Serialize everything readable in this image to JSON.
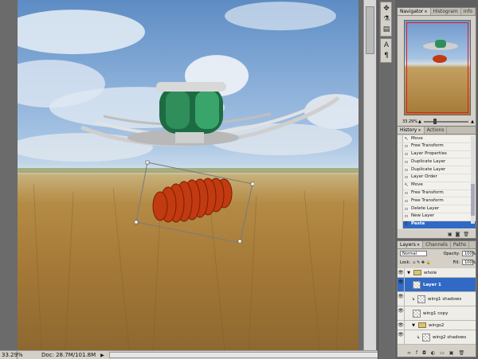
{
  "status": {
    "zoom": "33.29%",
    "doc": "Doc: 28.7M/101.8M"
  },
  "tool_icons": [
    "move-arrows-icon",
    "brush-stack-icon",
    "layer-comp-icon",
    "character-icon",
    "paragraph-icon"
  ],
  "navigator": {
    "tabs": [
      "Navigator",
      "Histogram",
      "Info"
    ],
    "zoom": "33.29%"
  },
  "history": {
    "tabs": [
      "History",
      "Actions"
    ],
    "items": [
      {
        "label": "Move",
        "icon": "move-arrow-icon"
      },
      {
        "label": "Free Transform",
        "icon": "transform-icon"
      },
      {
        "label": "Layer Properties",
        "icon": "layer-icon"
      },
      {
        "label": "Duplicate Layer",
        "icon": "layer-icon"
      },
      {
        "label": "Duplicate Layer",
        "icon": "layer-icon"
      },
      {
        "label": "Layer Order",
        "icon": "layer-icon"
      },
      {
        "label": "Move",
        "icon": "move-arrow-icon"
      },
      {
        "label": "Free Transform",
        "icon": "transform-icon"
      },
      {
        "label": "Free Transform",
        "icon": "transform-icon"
      },
      {
        "label": "Delete Layer",
        "icon": "layer-icon"
      },
      {
        "label": "New Layer",
        "icon": "layer-icon"
      },
      {
        "label": "Paste",
        "icon": "paste-icon",
        "selected": true
      }
    ]
  },
  "layers": {
    "tabs": [
      "Layers",
      "Channels",
      "Paths"
    ],
    "blend_mode": "Normal",
    "opacity_label": "Opacity:",
    "opacity": "100%",
    "lock_label": "Lock:",
    "fill_label": "Fill:",
    "fill": "100%",
    "items": [
      {
        "name": "whole",
        "type": "group"
      },
      {
        "name": "Layer 1",
        "type": "layer",
        "selected": true
      },
      {
        "name": "wing1 shadows",
        "type": "layer"
      },
      {
        "name": "wing1 copy",
        "type": "layer"
      },
      {
        "name": "wings2",
        "type": "group"
      },
      {
        "name": "wing2 shadows",
        "type": "layer"
      }
    ]
  },
  "colors": {
    "selection": "#316ac5",
    "panel_bg": "#d4d0c8",
    "navigator_view_box": "#e21c1c"
  }
}
